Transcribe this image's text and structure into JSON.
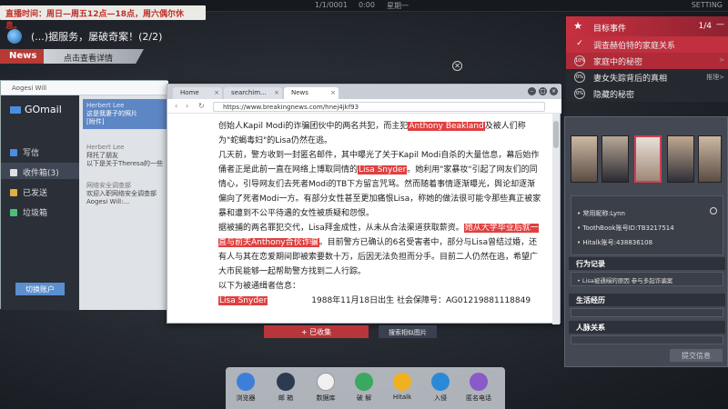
{
  "topbar": {
    "date": "1/1/0001",
    "time": "0:00",
    "weekday": "星期一",
    "settings_label": "SETTING"
  },
  "schedule": {
    "text": "直播时间：周日—周五12点—18点，周六偶尔休息。"
  },
  "ticker": {
    "text": "(...)据服务，屡破奇案！(2/2)",
    "news_badge": "News",
    "details_label": "点击查看详情"
  },
  "mail": {
    "header_user": "Aogesi Will",
    "app_title": "GOmail",
    "nav": [
      {
        "label": "写信",
        "color": "#4a8ee0"
      },
      {
        "label": "收件箱(3)",
        "color": "#e0e0e0"
      },
      {
        "label": "已发送",
        "color": "#e0b040"
      },
      {
        "label": "垃圾箱",
        "color": "#4ac07a"
      }
    ],
    "switch_account": "切换账户",
    "messages": [
      {
        "from": "Herbert Lee",
        "line1": "这是我妻子的照片",
        "line2": "[附件]"
      },
      {
        "from": "Herbert Lee",
        "line1": "拜托了朋友",
        "line2": "以下是关于Theresa的一些"
      },
      {
        "from": "网络安全调查部",
        "line1": "欢迎入职网络安全调查部",
        "line2": "Aogesi Will:..."
      }
    ]
  },
  "browser": {
    "tabs": [
      {
        "label": "Home"
      },
      {
        "label": "searchim..."
      },
      {
        "label": "News"
      }
    ],
    "url": "https://www.breakingnews.com/hnej4jkf93",
    "article": {
      "p1_a": "创始人Kapil Modi的诈骗团伙中的两名共犯，而主犯",
      "p1_hl": "Anthony Beakland",
      "p1_b": "及被人们称为\"蛇蝎毒妇\"的Lisa仍然在逃。",
      "p2_a": "几天前，警方收到一封匿名邮件，其中曝光了关于Kapil Modi自杀的大量信息，幕后始作俑者正是此前一直在网络上博取同情的",
      "p2_hl": "Lisa Snyder",
      "p2_b": "。她利用\"家暴妆\"引起了网友们的同情心，引导网友们去死者Modi的TB下方留言咒骂。然而随着事情逐渐曝光，舆论却逐渐偏向了死者Modi一方。有部分女性甚至更加痛恨Lisa，称她的做法很可能令那些真正被家暴和遭到不公平待遇的女性被质疑和怨恨。",
      "p3_a": "据被捕的两名罪犯交代，Lisa拜金成性，从未从合法渠道获取薪资。",
      "p3_hl": "她从大学毕业后就一直与前夫Anthony合伙诈骗",
      "p3_b": "。目前警方已确认的6名受害者中，部分与Lisa曾结过婚，还有人与其在恋爱期间即被索要数十万，后因无法负担而分手。目前二人仍然在逃，希望广大市民能够一起帮助警方找到二人行踪。",
      "p4": "以下为被通缉者信息：",
      "wanted_name": "Lisa Snyder",
      "wanted_info": "1988年11月18日出生  社会保障号：AG01219881118849"
    }
  },
  "actions": {
    "collected": "+ 已收集",
    "search_images": "搜索相似图片"
  },
  "dock": [
    {
      "label": "浏览器",
      "color": "#3d7fd8"
    },
    {
      "label": "邮 箱",
      "color": "#2c3a52"
    },
    {
      "label": "数据库",
      "color": "#f0f0f0"
    },
    {
      "label": "破 解",
      "color": "#3aa860"
    },
    {
      "label": "Hitalk",
      "color": "#f0b020"
    },
    {
      "label": "入侵",
      "color": "#2a8ad8"
    },
    {
      "label": "匿名电话",
      "color": "#8a5ac8"
    }
  ],
  "objectives": {
    "title": "目标事件",
    "count": "1/4",
    "items": [
      {
        "label": "调查赫伯特的家庭关系",
        "ring": "✓",
        "tag": ""
      },
      {
        "label": "家庭中的秘密",
        "ring": "10%",
        "tag": ">"
      },
      {
        "label": "妻女失踪背后的真相",
        "ring": "0%",
        "tag": "推理>"
      },
      {
        "label": "隐藏的秘密",
        "ring": "0%",
        "tag": ""
      }
    ]
  },
  "profile": {
    "info": [
      "• 常用昵称:Lynn",
      "• ToothBook账号ID:TB3217514",
      "• Hitalk账号:438836108"
    ],
    "sections": [
      {
        "title": "行为记录",
        "items": [
          "• Lisa被通缉的原因 参与多起诈骗案"
        ]
      },
      {
        "title": "生活经历",
        "items": []
      },
      {
        "title": "人脉关系",
        "items": []
      }
    ],
    "submit": "提交信息"
  }
}
